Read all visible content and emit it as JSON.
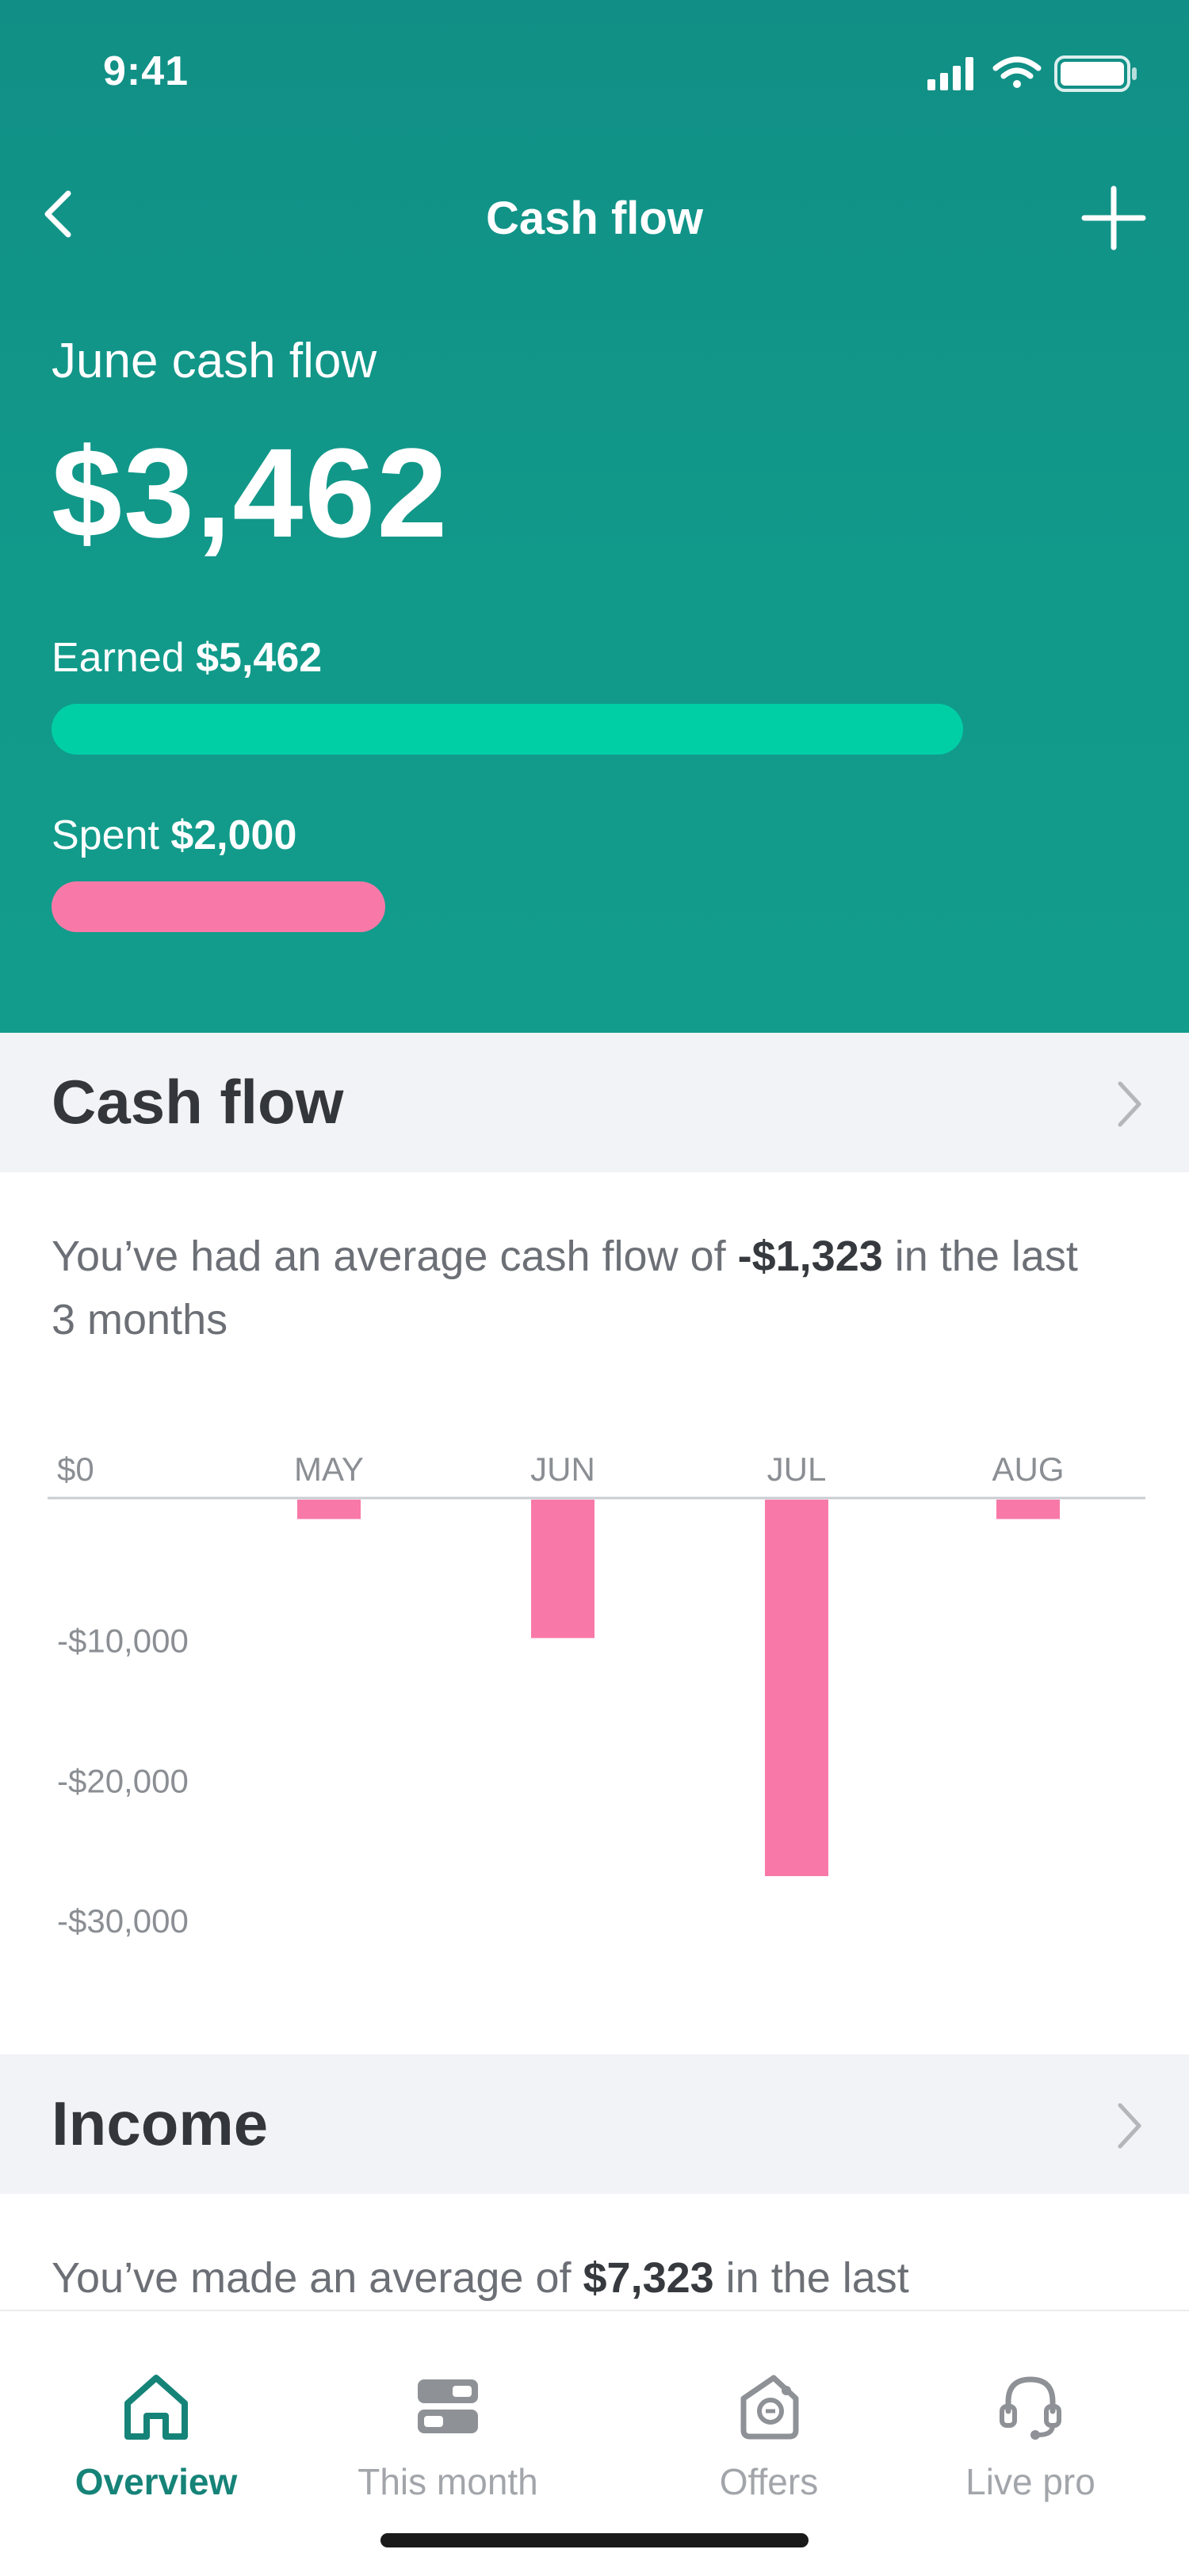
{
  "status_bar": {
    "time": "9:41"
  },
  "nav": {
    "title": "Cash flow",
    "back_icon": "chevron-left-icon",
    "add_icon": "plus-icon"
  },
  "summary": {
    "label": "June cash flow",
    "amount": "$3,462",
    "earned_label": "Earned",
    "earned_value": "$5,462",
    "earned_fraction": 1.0,
    "spent_label": "Spent",
    "spent_value": "$2,000",
    "spent_fraction": 0.366,
    "colors": {
      "earned": "#00cfa6",
      "spent": "#f879a8",
      "header": "#119a8a"
    }
  },
  "cash_flow_section": {
    "title": "Cash flow",
    "desc_prefix": "You’ve had an average cash flow of ",
    "desc_value": "-$1,323",
    "desc_suffix": " in the last 3 months"
  },
  "chart_data": {
    "type": "bar",
    "categories": [
      "MAY",
      "JUN",
      "JUL",
      "AUG"
    ],
    "values": [
      -1500,
      -10000,
      -27000,
      -1500
    ],
    "ytick_labels": [
      "$0",
      "-$10,000",
      "-$20,000",
      "-$30,000"
    ],
    "ylim": [
      -30000,
      0
    ],
    "bar_color": "#f879a8",
    "xlabel": "",
    "ylabel": ""
  },
  "income_section": {
    "title": "Income",
    "desc_prefix": "You’ve made an average of ",
    "desc_value": "$7,323",
    "desc_suffix": " in the last"
  },
  "tabbar": {
    "items": [
      {
        "label": "Overview",
        "icon": "home-icon",
        "active": true
      },
      {
        "label": "This month",
        "icon": "calendar-blocks-icon",
        "active": false
      },
      {
        "label": "Offers",
        "icon": "offers-icon",
        "active": false
      },
      {
        "label": "Live pro",
        "icon": "headset-icon",
        "active": false
      }
    ],
    "active_color": "#168378"
  }
}
